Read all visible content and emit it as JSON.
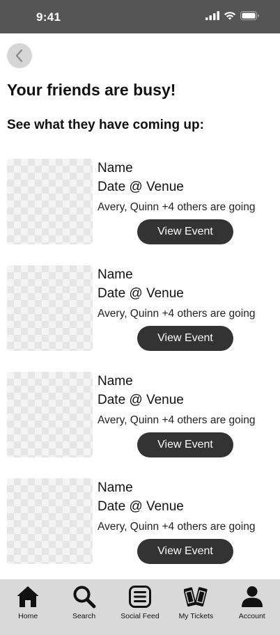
{
  "status_bar": {
    "time": "9:41"
  },
  "header": {
    "title": "Your friends are busy!",
    "subtitle": "See what they have coming up:"
  },
  "events": [
    {
      "name": "Name",
      "date_venue": "Date @ Venue",
      "friends": "Avery, Quinn +4 others are going",
      "button_label": "View Event"
    },
    {
      "name": "Name",
      "date_venue": "Date @ Venue",
      "friends": "Avery, Quinn +4 others are going",
      "button_label": "View Event"
    },
    {
      "name": "Name",
      "date_venue": "Date @ Venue",
      "friends": "Avery, Quinn +4 others are going",
      "button_label": "View Event"
    },
    {
      "name": "Name",
      "date_venue": "Date @ Venue",
      "friends": "Avery, Quinn +4 others are going",
      "button_label": "View Event"
    }
  ],
  "tab_bar": {
    "items": [
      {
        "label": "Home",
        "icon": "home-icon"
      },
      {
        "label": "Search",
        "icon": "search-icon"
      },
      {
        "label": "Social Feed",
        "icon": "feed-icon"
      },
      {
        "label": "My Tickets",
        "icon": "tickets-icon"
      },
      {
        "label": "Account",
        "icon": "account-icon"
      }
    ]
  },
  "colors": {
    "status_bar": "#555555",
    "button": "#333333",
    "tab_bar": "#d9d9d9",
    "back_button": "#d6d6d6"
  }
}
